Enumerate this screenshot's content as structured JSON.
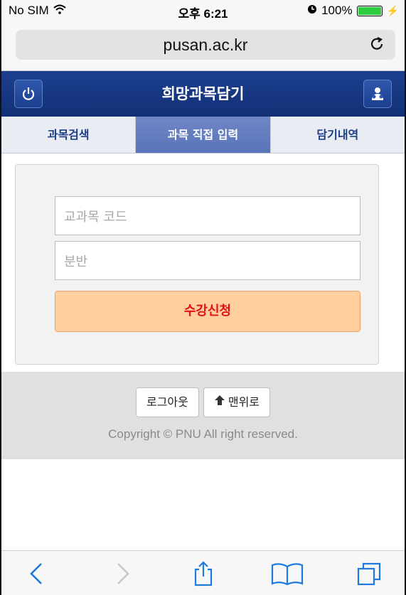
{
  "status_bar": {
    "carrier": "No SIM",
    "time": "오후 6:21",
    "battery": "100%"
  },
  "browser": {
    "url": "pusan.ac.kr"
  },
  "app": {
    "title": "희망과목담기",
    "tabs": [
      {
        "label": "과목검색"
      },
      {
        "label": "과목 직접 입력"
      },
      {
        "label": "담기내역"
      }
    ],
    "active_tab": 1
  },
  "form": {
    "course_code_placeholder": "교과목 코드",
    "section_placeholder": "분반",
    "apply_button": "수강신청"
  },
  "footer": {
    "logout_button": "로그아웃",
    "top_button": "맨위로",
    "copyright": "Copyright © PNU All right reserved."
  },
  "colors": {
    "header": "#1d3f8f",
    "active_tab": "#6f86c6",
    "apply_bg": "#ffcfa0",
    "apply_text": "#e21212"
  }
}
